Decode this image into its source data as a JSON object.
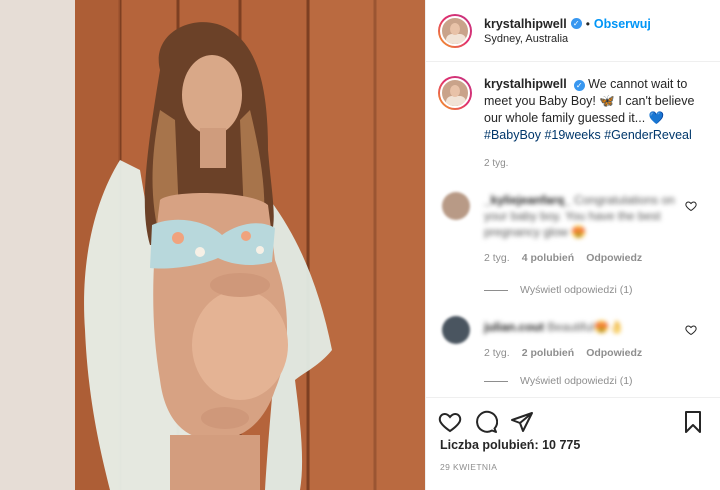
{
  "post": {
    "username": "krystalhipwell",
    "verified_icon": "verified-badge-icon",
    "separator": "•",
    "follow_label": "Obserwuj",
    "location": "Sydney, Australia"
  },
  "caption": {
    "username": "krystalhipwell",
    "text": "We cannot wait to meet you Baby Boy! 🦋 I can't believe our whole family guessed it... 💙",
    "hashtags": "#BabyBoy #19weeks #GenderReveal",
    "time": "2 tyg."
  },
  "comments": [
    {
      "username": "_kyliejeanfarq_",
      "text": "Congratulations on your baby boy. You have the best pregnancy glow 😍",
      "time": "2 tyg.",
      "likes": "4 polubień",
      "reply_label": "Odpowiedz",
      "view_replies": "Wyświetl odpowiedzi (1)"
    },
    {
      "username": "julian.cout",
      "text": "Beautiful😍👌",
      "time": "2 tyg.",
      "likes": "2 polubień",
      "reply_label": "Odpowiedz",
      "view_replies": "Wyświetl odpowiedzi (1)"
    }
  ],
  "footer": {
    "likes_text": "Liczba polubień: 10 775",
    "date": "29 KWIETNIA"
  },
  "colors": {
    "accent": "#0095f6",
    "hashtag": "#00376b",
    "muted": "#8e8e8e",
    "verified": "#3897f0"
  }
}
